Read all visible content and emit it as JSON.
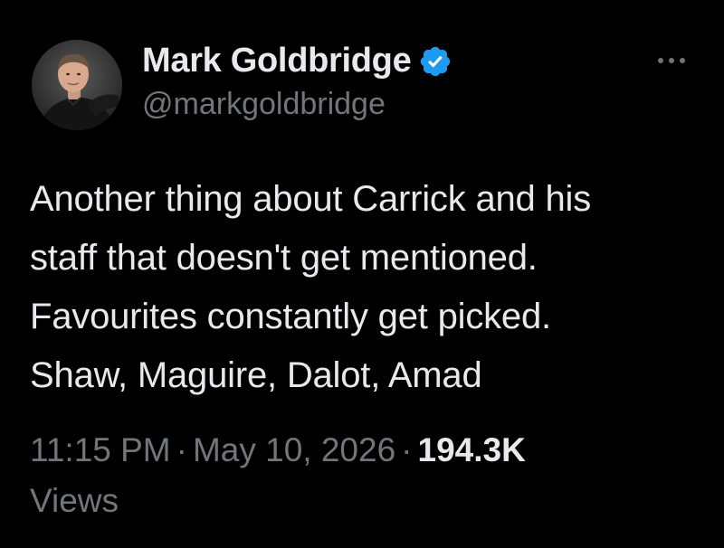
{
  "author": {
    "display_name": "Mark Goldbridge",
    "handle": "@markgoldbridge",
    "verified": true,
    "verified_color": "#1d9bf0",
    "avatar_icon": "profile-photo"
  },
  "tweet": {
    "lines": [
      "Another thing about Carrick and his",
      "staff that doesn't get mentioned.",
      "Favourites constantly get picked.",
      "Shaw, Maguire, Dalot, Amad"
    ]
  },
  "meta": {
    "time": "11:15 PM",
    "separator": "·",
    "date": "May 10, 2026",
    "views_count": "194.3K",
    "views_label": "Views"
  },
  "icons": {
    "more": "more-horizontal-icon",
    "verified": "verified-badge-icon"
  },
  "colors": {
    "background": "#000000",
    "primary_text": "#e7e9ea",
    "secondary_text": "#71767b"
  }
}
